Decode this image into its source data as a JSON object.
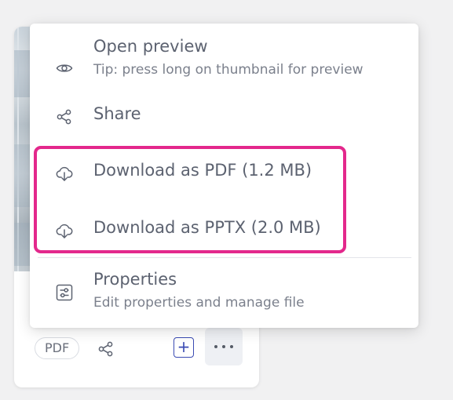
{
  "card": {
    "format_chip": "PDF",
    "add_label": "+",
    "icons": {
      "share": "share-icon",
      "more": "more-horizontal-icon"
    }
  },
  "menu": {
    "items": [
      {
        "title": "Open preview",
        "subtitle": "Tip: press long on thumbnail for preview",
        "icon": "eye-icon"
      },
      {
        "title": "Share",
        "icon": "share-icon"
      },
      {
        "title": "Download as PDF (1.2 MB)",
        "icon": "cloud-download-icon"
      },
      {
        "title": "Download as PPTX (2.0 MB)",
        "icon": "cloud-download-icon"
      },
      {
        "title": "Properties",
        "subtitle": "Edit properties and manage file",
        "icon": "sliders-icon"
      }
    ]
  },
  "colors": {
    "highlight": "#e3288c",
    "accent": "#3b4bb3",
    "text": "#5c6270"
  }
}
